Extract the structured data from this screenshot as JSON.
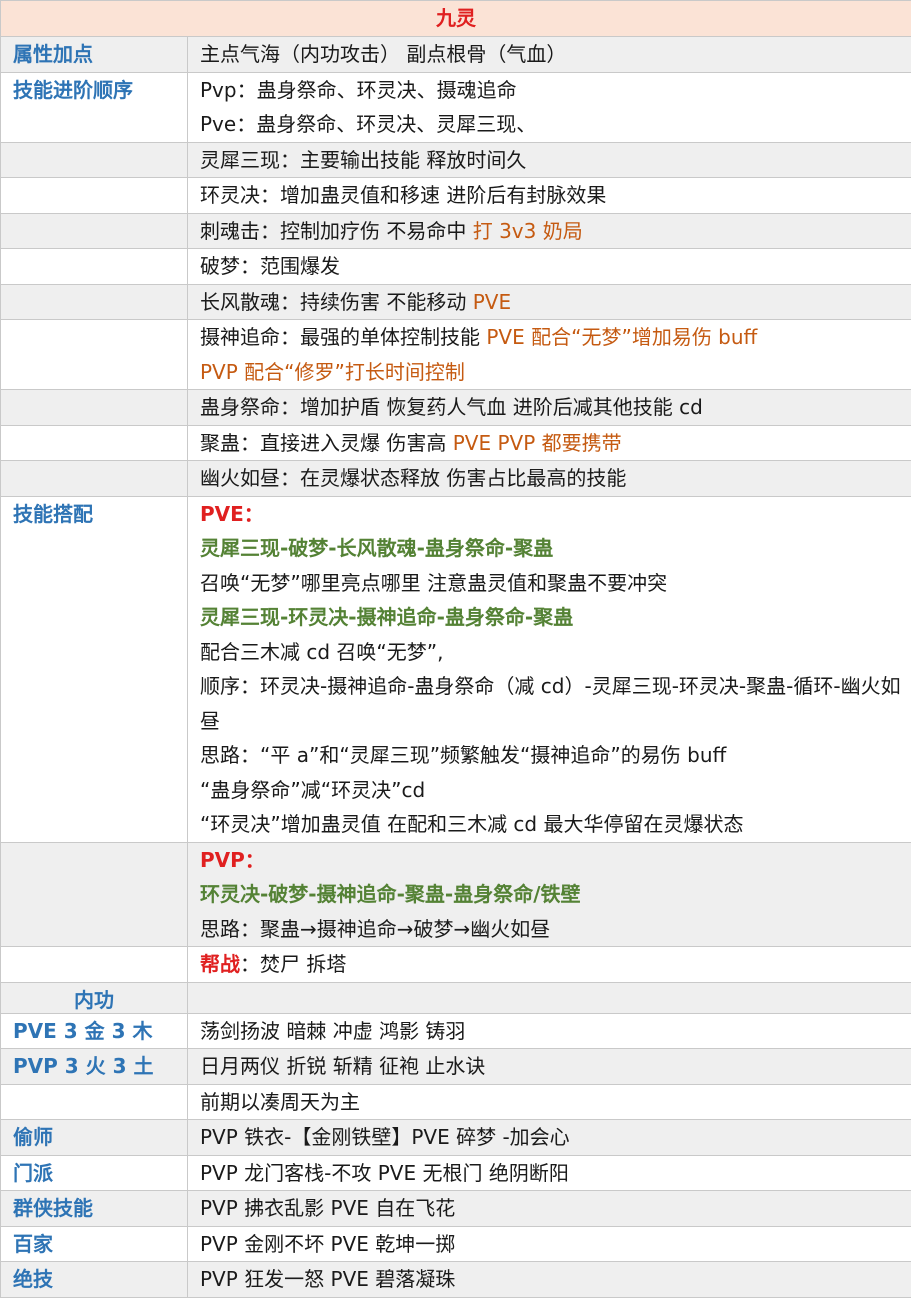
{
  "title": "九灵",
  "rows": {
    "attr_label": "属性加点",
    "attr_value": "主点气海（内功攻击） 副点根骨（气血）",
    "order_label": "技能进阶顺序",
    "order_pvp": "Pvp：蛊身祭命、环灵决、摄魂追命",
    "order_pve": "Pve：蛊身祭命、环灵决、灵犀三现、",
    "s1": "灵犀三现：主要输出技能 释放时间久",
    "s2": "环灵决：增加蛊灵值和移速 进阶后有封脉效果",
    "s3a": "刺魂击：控制加疗伤 不易命中 ",
    "s3b": "打 3v3 奶局",
    "s4": "破梦：范围爆发",
    "s5a": "长风散魂：持续伤害 不能移动 ",
    "s5b": "PVE",
    "s6a": "摄神追命：最强的单体控制技能 ",
    "s6b": "PVE 配合“无梦”增加易伤 buff",
    "s6c": "PVP 配合“修罗”打长时间控制",
    "s7": "蛊身祭命：增加护盾 恢复药人气血 进阶后减其他技能 cd",
    "s8a": "聚蛊：直接进入灵爆 伤害高 ",
    "s8b": "PVE PVP 都要携带",
    "s9": "幽火如昼：在灵爆状态释放 伤害占比最高的技能",
    "combo_label": "技能搭配",
    "pve_head": "PVE：",
    "pve_c1": "灵犀三现-破梦-长风散魂-蛊身祭命-聚蛊",
    "pve_t1": "召唤“无梦”哪里亮点哪里 注意蛊灵值和聚蛊不要冲突",
    "pve_c2": "灵犀三现-环灵决-摄神追命-蛊身祭命-聚蛊",
    "pve_t2": "配合三木减 cd 召唤“无梦”,",
    "pve_t3": "顺序：环灵决-摄神追命-蛊身祭命（减 cd）-灵犀三现-环灵决-聚蛊-循环-幽火如昼",
    "pve_t4": "思路：“平 a”和“灵犀三现”频繁触发“摄神追命”的易伤 buff",
    "pve_t5": "“蛊身祭命”减“环灵决”cd",
    "pve_t6": "“环灵决”增加蛊灵值 在配和三木减 cd 最大华停留在灵爆状态",
    "pvp_head": "PVP：",
    "pvp_c1": "环灵决-破梦-摄神追命-聚蛊-蛊身祭命/铁壁",
    "pvp_t1": "思路：聚蛊→摄神追命→破梦→幽火如昼",
    "guild_a": "帮战",
    "guild_b": "：焚尸 拆塔",
    "neigong_label": "内功",
    "pve_ng_label": "PVE 3 金 3 木",
    "pve_ng_value": "荡剑扬波 暗棘 冲虚 鸿影 铸羽",
    "pvp_ng_label": "PVP 3 火 3 土",
    "pvp_ng_value": "日月两仪 折锐 斩精 征袍 止水诀",
    "early_value": "前期以凑周天为主",
    "steal_label": "偷师",
    "steal_value": "PVP 铁衣-【金刚铁壁】PVE 碎梦 -加会心",
    "sect_label": "门派",
    "sect_value": "PVP 龙门客栈-不攻 PVE 无根门 绝阴断阳",
    "hero_label": "群侠技能",
    "hero_value": "PVP 拂衣乱影 PVE 自在飞花",
    "hundred_label": "百家",
    "hundred_value": "PVP 金刚不坏 PVE 乾坤一掷",
    "ult_label": "绝技",
    "ult_value": "PVP 狂发一怒 PVE 碧落凝珠"
  }
}
